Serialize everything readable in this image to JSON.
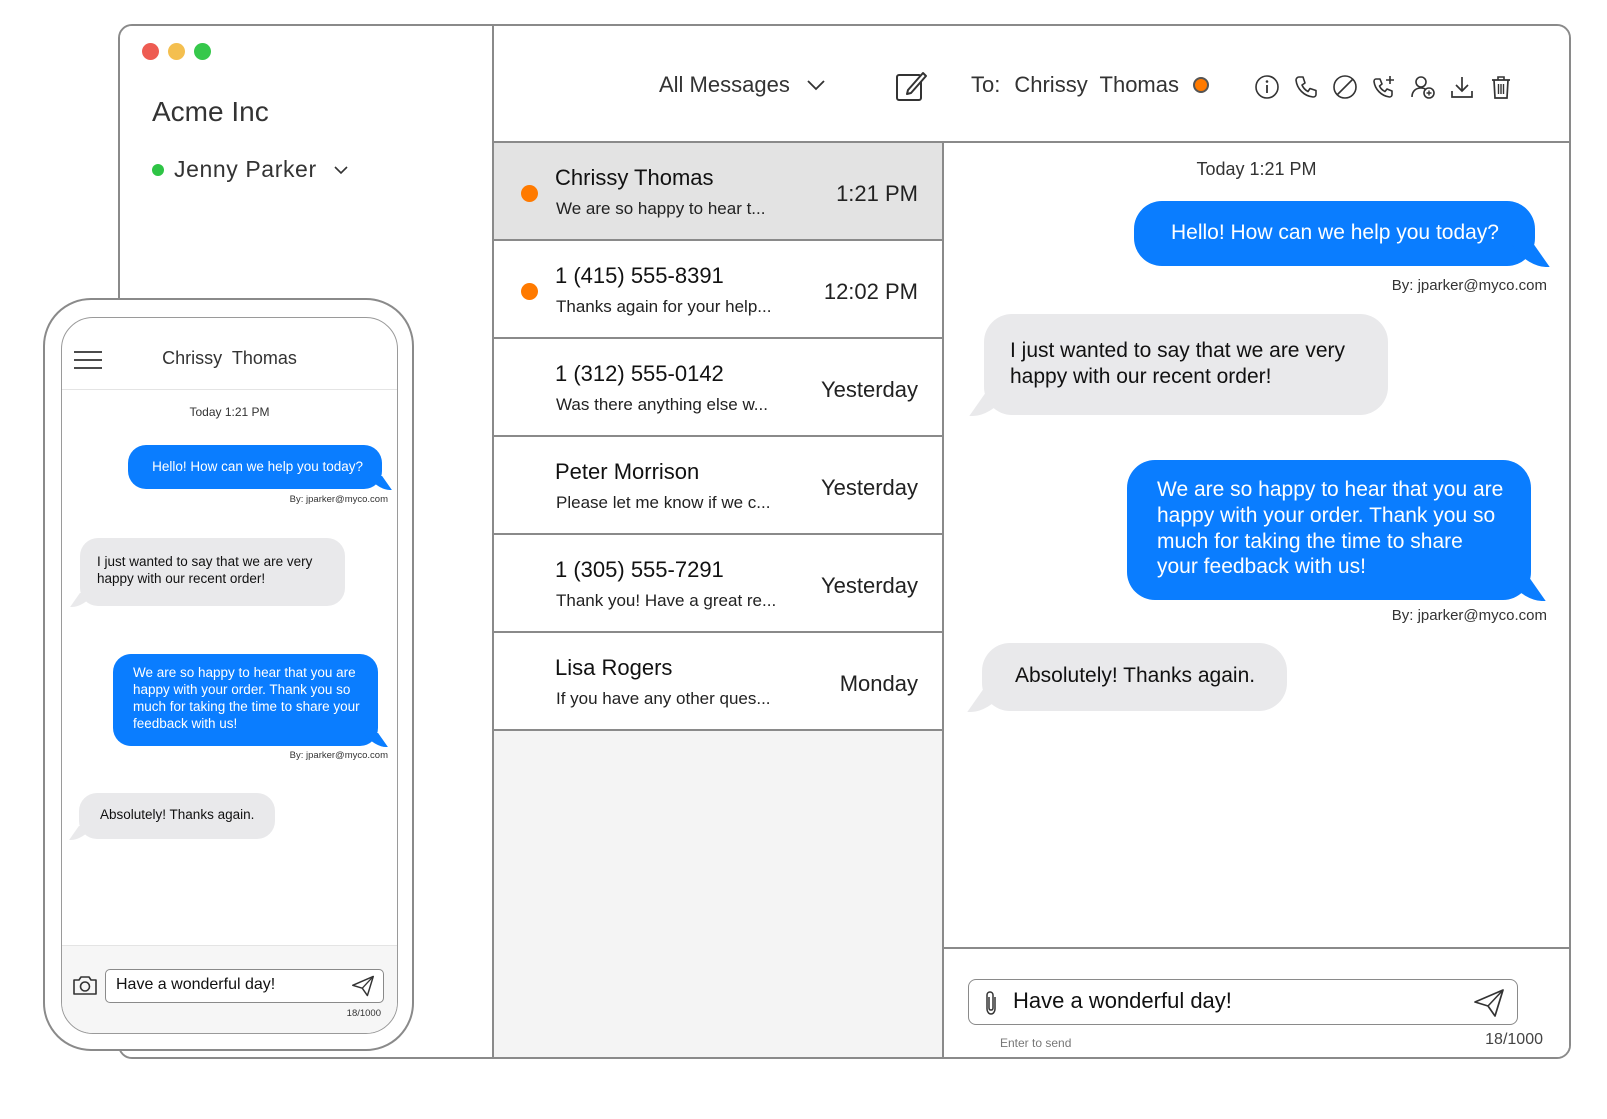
{
  "window": {
    "traffic_lights": {
      "close": "#ee5c52",
      "minimize": "#f4bf4f",
      "maximize": "#36c84b"
    }
  },
  "sidebar": {
    "org_name": "Acme Inc",
    "user": {
      "name": "Jenny Parker",
      "status_color": "#2ec445"
    }
  },
  "topbar": {
    "filter_label": "All Messages",
    "to_prefix": "To:",
    "recipient": "Chrissy  Thomas",
    "recipient_status_color": "#ff7a00",
    "actions": [
      "info-icon",
      "phone-icon",
      "block-icon",
      "add-call-icon",
      "add-contact-icon",
      "download-icon",
      "trash-icon"
    ]
  },
  "conversations": [
    {
      "name": "Chrissy Thomas",
      "preview": "We are so happy to hear t...",
      "time": "1:21 PM",
      "unread": true,
      "selected": true
    },
    {
      "name": "1 (415) 555-8391",
      "preview": "Thanks again for your help...",
      "time": "12:02 PM",
      "unread": true,
      "selected": false
    },
    {
      "name": "1 (312) 555-0142",
      "preview": "Was there anything else w...",
      "time": "Yesterday",
      "unread": false,
      "selected": false
    },
    {
      "name": "Peter Morrison",
      "preview": "Please let me know if we c...",
      "time": "Yesterday",
      "unread": false,
      "selected": false
    },
    {
      "name": "1 (305) 555-7291",
      "preview": "Thank you! Have a great re...",
      "time": "Yesterday",
      "unread": false,
      "selected": false
    },
    {
      "name": "Lisa Rogers",
      "preview": "If you have any other ques...",
      "time": "Monday",
      "unread": false,
      "selected": false
    }
  ],
  "chat": {
    "date_label": "Today 1:21 PM",
    "messages": [
      {
        "direction": "out",
        "text": "Hello! How can we help you today?",
        "byline": "By: jparker@myco.com"
      },
      {
        "direction": "in",
        "text": "I just wanted to say that we are very happy with our recent order!"
      },
      {
        "direction": "out",
        "text": "We are so happy to hear that you are happy with your order. Thank you so much for taking the time to share your feedback with us!",
        "byline": "By: jparker@myco.com"
      },
      {
        "direction": "in",
        "text": "Absolutely! Thanks again."
      }
    ],
    "composer": {
      "value": "Have a wonderful day!",
      "hint": "Enter to send",
      "counter": "18/1000"
    }
  },
  "phone": {
    "title": "Chrissy  Thomas",
    "date_label": "Today 1:21 PM",
    "composer": {
      "value": "Have a wonderful day!",
      "counter": "18/1000"
    }
  },
  "colors": {
    "accent": "#0a7dff",
    "incoming_bubble": "#e9e9eb",
    "unread": "#ff7a00",
    "border": "#8a8a8a"
  }
}
